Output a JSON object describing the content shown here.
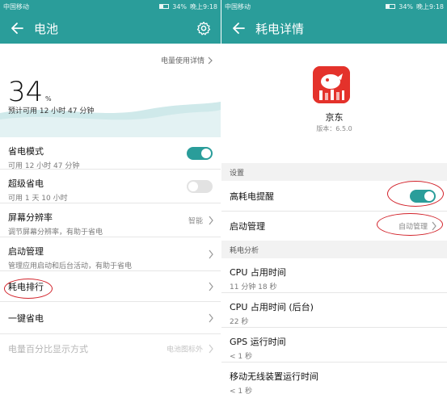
{
  "status_bar": {
    "carrier": "中国移动",
    "battery_pct": "34%",
    "time": "晚上9:18"
  },
  "left": {
    "title": "电池",
    "usage_link": "电量使用详情",
    "percent": "34",
    "percent_sign": "%",
    "estimate": "预计可用 12 小时 47 分钟",
    "rows": [
      {
        "label": "省电模式",
        "sub": "可用 12 小时 47 分钟",
        "toggle": true
      },
      {
        "label": "超级省电",
        "sub": "可用 1 天 10 小时",
        "toggle": false
      },
      {
        "label": "屏幕分辨率",
        "sub": "调节屏幕分辨率，有助于省电",
        "value": "智能"
      },
      {
        "label": "启动管理",
        "sub": "管理应用启动和后台活动，有助于省电"
      },
      {
        "label": "耗电排行"
      },
      {
        "label": "一键省电"
      },
      {
        "label": "电量百分比显示方式",
        "value": "电池图标外"
      }
    ]
  },
  "right": {
    "title": "耗电详情",
    "app_name": "京东",
    "app_version": "版本：6.5.0",
    "settings_header": "设置",
    "high_drain_label": "高耗电提醒",
    "high_drain_on": true,
    "startup_label": "启动管理",
    "startup_value": "自动管理",
    "analysis_header": "耗电分析",
    "analysis": [
      {
        "label": "CPU 占用时间",
        "value": "11 分钟 18 秒"
      },
      {
        "label": "CPU 占用时间 (后台)",
        "value": "22 秒"
      },
      {
        "label": "GPS 运行时间",
        "value": "< 1 秒"
      },
      {
        "label": "移动无线装置运行时间",
        "value": "< 1 秒"
      }
    ]
  },
  "colors": {
    "accent": "#2a9d9a",
    "annotation": "#d2222a",
    "app_icon": "#e4322b"
  }
}
